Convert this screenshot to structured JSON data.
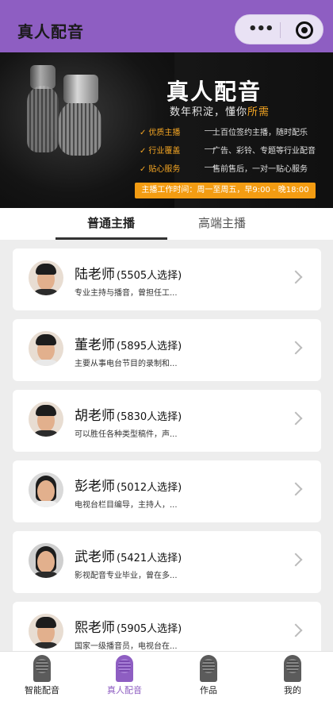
{
  "header": {
    "title": "真人配音"
  },
  "banner": {
    "title": "真人配音",
    "subtitle_prefix": "数年积淀，懂你",
    "subtitle_highlight": "所需",
    "features": [
      {
        "label": "优质主播",
        "desc": "上百位签约主播，随时配乐"
      },
      {
        "label": "行业覆盖",
        "desc": "广告、彩铃、专题等行业配音"
      },
      {
        "label": "贴心服务",
        "desc": "售前售后，一对一贴心服务"
      }
    ],
    "hours": "主播工作时间：周一至周五，早9:00 - 晚18:00",
    "accent_color": "#f5a623"
  },
  "tabs": [
    {
      "label": "普通主播",
      "active": true
    },
    {
      "label": "高端主播",
      "active": false
    }
  ],
  "anchors": [
    {
      "name": "陆老师",
      "count": "(5505人选择)",
      "desc": "专业主持与播音，曾担任工...",
      "avatar": "male"
    },
    {
      "name": "董老师",
      "count": "(5895人选择)",
      "desc": "主要从事电台节目的录制和...",
      "avatar": "male"
    },
    {
      "name": "胡老师",
      "count": "(5830人选择)",
      "desc": "可以胜任各种类型稿件，声...",
      "avatar": "male"
    },
    {
      "name": "彭老师",
      "count": "(5012人选择)",
      "desc": "电视台栏目编导，主持人，...",
      "avatar": "female"
    },
    {
      "name": "武老师",
      "count": "(5421人选择)",
      "desc": "影视配音专业毕业，曾在多...",
      "avatar": "female"
    },
    {
      "name": "熙老师",
      "count": "(5905人选择)",
      "desc": "国家一级播音员，电视台在...",
      "avatar": "male"
    }
  ],
  "bottom_nav": [
    {
      "label": "智能配音",
      "icon": "microphone-icon",
      "active": false
    },
    {
      "label": "真人配音",
      "icon": "microphone-icon",
      "active": true
    },
    {
      "label": "作品",
      "icon": "microphone-icon",
      "active": false
    },
    {
      "label": "我的",
      "icon": "microphone-icon",
      "active": false
    }
  ],
  "colors": {
    "brand": "#8e5ec2",
    "accent": "#f39c12"
  }
}
